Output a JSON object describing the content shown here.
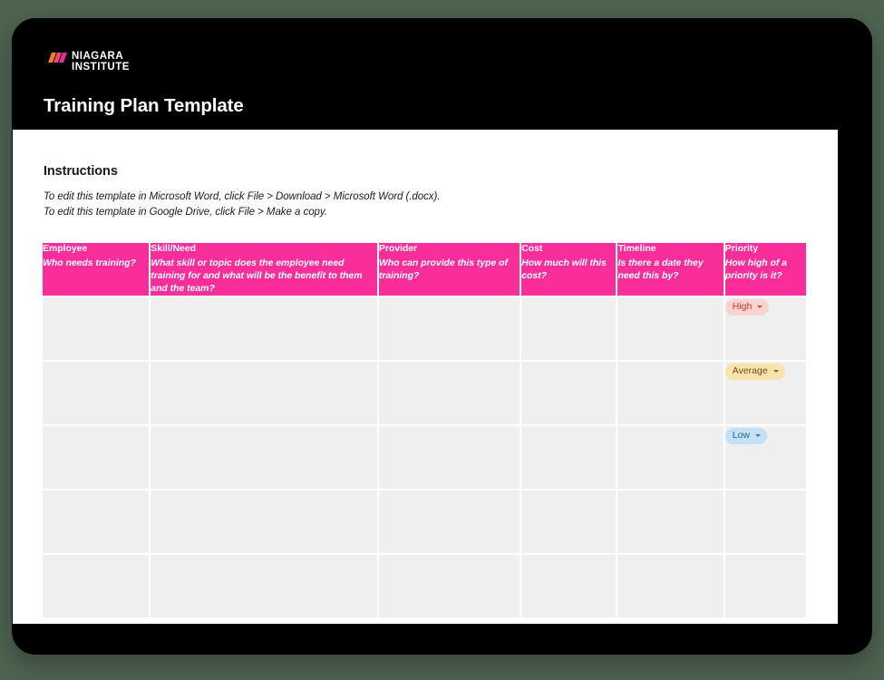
{
  "brand": {
    "mark_name": "niagara-slash-mark",
    "line1": "NIAGARA",
    "line2": "INSTITUTE",
    "mark_colors": [
      "#f07f2a",
      "#ef4a6a",
      "#e0319b"
    ]
  },
  "header": {
    "title": "Training Plan Template",
    "background": "#000000",
    "text_color": "#ffffff"
  },
  "instructions": {
    "heading": "Instructions",
    "lines": [
      "To edit this template in Microsoft Word, click File > Download > Microsoft Word (.docx).",
      "To edit this template in Google Drive, click File > Make a copy."
    ]
  },
  "table": {
    "header_background": "#fa2e9b",
    "cell_background": "#efefef",
    "columns": [
      {
        "title": "Employee",
        "subtitle": "Who needs training?"
      },
      {
        "title": "Skill/Need",
        "subtitle": "What skill or topic does the employee need training for and what will be the benefit to them and the team?"
      },
      {
        "title": "Provider",
        "subtitle": "Who can provide this type of training?"
      },
      {
        "title": "Cost",
        "subtitle": "How much will this cost?"
      },
      {
        "title": "Timeline",
        "subtitle": "Is there a date they need this by?"
      },
      {
        "title": "Priority",
        "subtitle": "How high of a priority is it?"
      }
    ],
    "rows": [
      {
        "employee": "",
        "skill": "",
        "provider": "",
        "cost": "",
        "timeline": "",
        "priority": "High"
      },
      {
        "employee": "",
        "skill": "",
        "provider": "",
        "cost": "",
        "timeline": "",
        "priority": "Average"
      },
      {
        "employee": "",
        "skill": "",
        "provider": "",
        "cost": "",
        "timeline": "",
        "priority": "Low"
      },
      {
        "employee": "",
        "skill": "",
        "provider": "",
        "cost": "",
        "timeline": "",
        "priority": ""
      },
      {
        "employee": "",
        "skill": "",
        "provider": "",
        "cost": "",
        "timeline": "",
        "priority": ""
      }
    ],
    "priority_options": [
      "High",
      "Average",
      "Low"
    ],
    "priority_colors": {
      "High": {
        "background": "#fcd3d0",
        "text": "#c0382c"
      },
      "Average": {
        "background": "#fae3ab",
        "text": "#6b5116"
      },
      "Low": {
        "background": "#c3e0f7",
        "text": "#2a6296"
      }
    }
  },
  "page": {
    "background": "#4e6350",
    "sheet_background": "#ffffff"
  }
}
